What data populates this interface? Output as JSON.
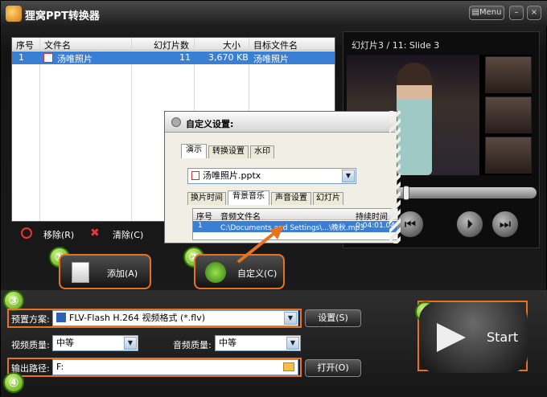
{
  "app": {
    "title": "狸窝PPT转换器",
    "menu_label": "Menu",
    "min_label": "–",
    "close_label": "×"
  },
  "filelist": {
    "headers": [
      "序号",
      "文件名",
      "幻灯片数",
      "大小",
      "目标文件名"
    ],
    "rows": [
      {
        "index": "1",
        "name": "汤唯照片",
        "slides": "11",
        "size": "3,670 KB",
        "target": "汤唯照片"
      }
    ],
    "remove_label": "移除(R)",
    "clear_label": "清除(C)"
  },
  "preview": {
    "title": "幻灯片3 / 11: Slide 3"
  },
  "buttons": {
    "add_label": "添加(A)",
    "custom_label": "自定义(C)",
    "start_label": "Start"
  },
  "steps": [
    "①",
    "②",
    "③",
    "④",
    "⑤"
  ],
  "settings": {
    "preset_label": "预置方案:",
    "preset_value": "FLV-Flash H.264 视频格式 (*.flv)",
    "settings_btn": "设置(S)",
    "video_quality_label": "视频质量:",
    "video_quality_value": "中等",
    "audio_quality_label": "音频质量:",
    "audio_quality_value": "中等",
    "output_label": "输出路径:",
    "output_value": "F:",
    "open_btn": "打开(O)"
  },
  "dialog": {
    "title": "自定义设置:",
    "tabs": [
      "演示",
      "转换设置",
      "水印"
    ],
    "file_value": "汤唯照片.pptx",
    "subtabs": [
      "换片时间",
      "背景音乐",
      "声音设置",
      "幻灯片"
    ],
    "music_headers": [
      "序号",
      "音频文件名",
      "持续时间"
    ],
    "music_row": {
      "index": "1",
      "file": "C:\\Documents and Settings\\...\\晚秋.mp3",
      "duration": "0:04:01.04"
    }
  },
  "colors": {
    "accent_orange": "#e8731f",
    "selection_blue": "#3b7fd4",
    "step_green": "#5aa812"
  }
}
